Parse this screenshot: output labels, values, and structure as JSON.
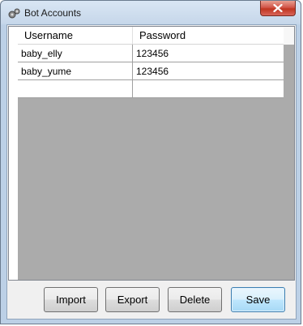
{
  "window": {
    "title": "Bot Accounts"
  },
  "grid": {
    "columns": [
      "Username",
      "Password"
    ],
    "rows": [
      [
        "baby_elly",
        "123456"
      ],
      [
        "baby_yume",
        "123456"
      ],
      [
        "",
        ""
      ]
    ]
  },
  "buttons": {
    "import": "Import",
    "export": "Export",
    "delete": "Delete",
    "save": "Save"
  },
  "icons": {
    "app": "gear-app-icon",
    "close": "close-icon"
  },
  "colors": {
    "close_button": "#c03520",
    "grid_background": "#ababab",
    "save_button": "#a7d9f5"
  }
}
